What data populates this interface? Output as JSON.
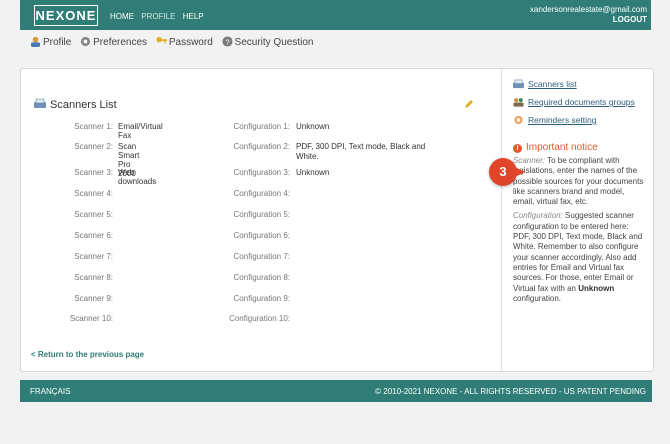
{
  "header": {
    "logo": "NEXONE",
    "nav": [
      "HOME",
      "PROFILE",
      "HELP"
    ],
    "account_email": "xandersonrealestate@gmail.com",
    "logout": "LOGOUT"
  },
  "subnav": {
    "items": [
      "Profile",
      "Preferences",
      "Password",
      "Security Question"
    ]
  },
  "main": {
    "title": "Scanners List",
    "scanners": [
      {
        "label": "Scanner 1:",
        "value": "Email/Virtual Fax",
        "config_label": "Configuration 1:",
        "config": "Unknown"
      },
      {
        "label": "Scanner 2:",
        "value": "Scan Smart Pro 2000",
        "config_label": "Configuration 2:",
        "config": "PDF, 300 DPI, Text mode, Black and White."
      },
      {
        "label": "Scanner 3:",
        "value": "Web downloads",
        "config_label": "Configuration 3:",
        "config": "Unknown"
      },
      {
        "label": "Scanner 4:",
        "value": "",
        "config_label": "Configuration 4:",
        "config": ""
      },
      {
        "label": "Scanner 5:",
        "value": "",
        "config_label": "Configuration 5:",
        "config": ""
      },
      {
        "label": "Scanner 6:",
        "value": "",
        "config_label": "Configuration 6:",
        "config": ""
      },
      {
        "label": "Scanner 7:",
        "value": "",
        "config_label": "Configuration 7:",
        "config": ""
      },
      {
        "label": "Scanner 8:",
        "value": "",
        "config_label": "Configuration 8:",
        "config": ""
      },
      {
        "label": "Scanner 9:",
        "value": "",
        "config_label": "Configuration 9:",
        "config": ""
      },
      {
        "label": "Scanner 10:",
        "value": "",
        "config_label": "Configuration 10:",
        "config": ""
      }
    ],
    "return_link": "< Return to the previous page"
  },
  "sidebar": {
    "links": [
      "Scanners list",
      "Required documents groups",
      "Reminders setting"
    ],
    "notice_title": "Important notice",
    "scanner_label": "Scanner:",
    "scanner_text": " To be compliant with legislations, enter the names of the possible sources for your documents like scanners brand and model, email, virtual fax, etc.",
    "config_label": "Configuration:",
    "config_text_1": " Suggested scanner configuration to be entered here: PDF, 300 DPI, Text mode, Black and White. Remember to also configure your scanner accordingly. Also add entries for Email and Virtual fax sources. For those, enter Email or Virtual fax with an ",
    "config_bold": "Unknown",
    "config_text_2": " configuration."
  },
  "callout": {
    "number": "3",
    "color": "#e0452b"
  },
  "footer": {
    "language": "FRANÇAIS",
    "copyright": "© 2010-2021 NEXONE - ALL RIGHTS RESERVED - US PATENT PENDING"
  },
  "colors": {
    "brand": "#2f7d76",
    "link": "#2f5e7a",
    "notice": "#e05a2b"
  }
}
